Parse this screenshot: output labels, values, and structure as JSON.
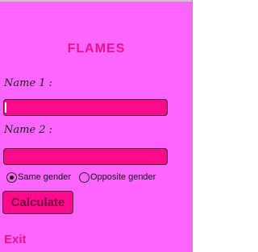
{
  "app": {
    "title": "FLAMES"
  },
  "form": {
    "name1_label": "Name 1 :",
    "name1_value": "",
    "name2_label": "Name 2 :",
    "name2_value": "",
    "gender_options": [
      {
        "label": "Same gender",
        "selected": true
      },
      {
        "label": "Opposite gender",
        "selected": false
      }
    ],
    "calculate_label": "Calculate",
    "exit_label": "Exit"
  },
  "colors": {
    "background": "#ff66ff",
    "accent": "#ff0a8c",
    "title": "#e8128a"
  }
}
